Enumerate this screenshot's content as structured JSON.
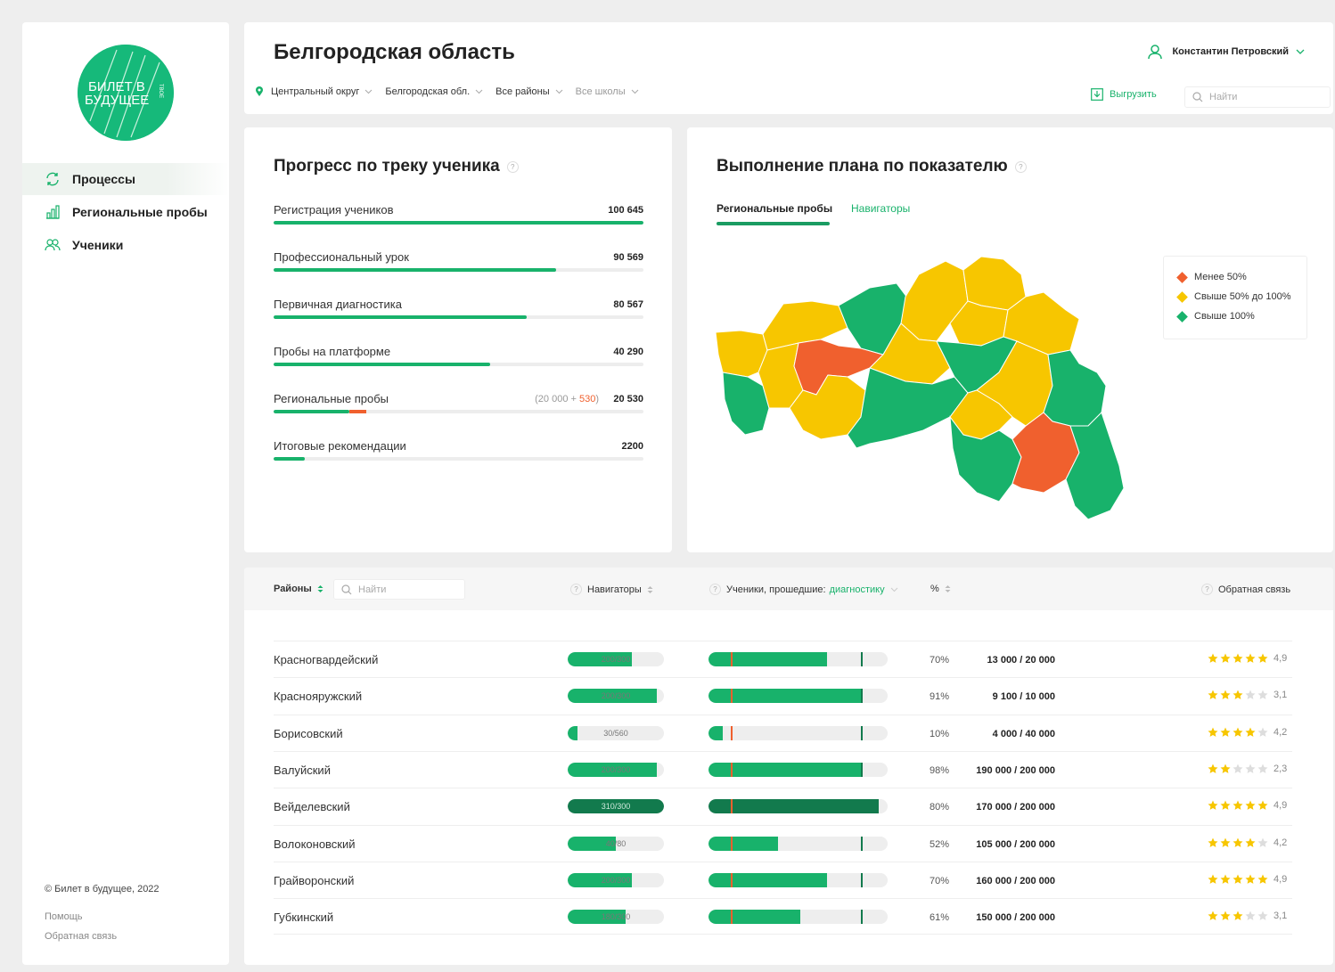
{
  "sidebar": {
    "logo_line1": "БИЛЕТ В",
    "logo_line2": "БУДУЩЕЕ",
    "logo_side": "ТВОЕ",
    "items": [
      {
        "label": "Процессы",
        "icon": "refresh-icon"
      },
      {
        "label": "Региональные пробы",
        "icon": "bar-chart-icon"
      },
      {
        "label": "Ученики",
        "icon": "users-icon"
      }
    ],
    "copyright": "© Билет в будущее, 2022",
    "help_link": "Помощь",
    "feedback_link": "Обратная связь"
  },
  "header": {
    "title": "Белгородская область",
    "user_name": "Константин Петровский",
    "filters": [
      "Центральный округ",
      "Белгородская обл.",
      "Все районы",
      "Все школы"
    ],
    "export_label": "Выгрузить",
    "search_placeholder": "Найти"
  },
  "progress": {
    "title": "Прогресс по треку ученика",
    "help": "?",
    "rows": [
      {
        "label": "Регистрация учеников",
        "value": "100 645",
        "fill": 1.0
      },
      {
        "label": "Профессиональный урок",
        "value": "90 569",
        "fill": 0.765
      },
      {
        "label": "Первичная диагностика",
        "value": "80 567",
        "fill": 0.685
      },
      {
        "label": "Пробы на платформе",
        "value": "40 290",
        "fill": 0.585
      },
      {
        "label": "Региональные пробы",
        "value": "20 530",
        "extra_base": "(20 000 + ",
        "extra_add": "530",
        "extra_close": ")",
        "fill": 0.205,
        "fill_add": 0.045
      },
      {
        "label": "Итоговые рекомендации",
        "value": "2200",
        "fill": 0.085
      }
    ]
  },
  "plan": {
    "title": "Выполнение плана по показателю",
    "help": "?",
    "tabs": [
      "Региональные пробы",
      "Навигаторы"
    ],
    "legend": [
      {
        "label": "Менее 50%",
        "color": "#f0602e"
      },
      {
        "label": "Свыше 50% до 100%",
        "color": "#f7c600"
      },
      {
        "label": "Свыше 100%",
        "color": "#18b26b"
      }
    ]
  },
  "table": {
    "headers": {
      "districts": "Районы",
      "search_placeholder": "Найти",
      "navigators": "Навигаторы",
      "students_prefix": "Ученики, прошедшие:",
      "students_link": "диагностику",
      "percent": "%",
      "feedback": "Обратная связь"
    },
    "rows": [
      {
        "name": "Красногвардейский",
        "nav_text": "200/300",
        "nav_fill": 0.667,
        "stu_fill": 0.66,
        "pct": "70%",
        "ratio": "13 000 / 20 000",
        "stars": 5,
        "rating": "4,9"
      },
      {
        "name": "Краснояружский",
        "nav_text": "200/300",
        "nav_fill": 0.93,
        "stu_fill": 0.86,
        "pct": "91%",
        "ratio": "9 100 / 10 000",
        "stars": 3,
        "rating": "3,1"
      },
      {
        "name": "Борисовский",
        "nav_text": "30/560",
        "nav_fill": 0.1,
        "stu_fill": 0.08,
        "pct": "10%",
        "ratio": "4 000 / 40 000",
        "stars": 4,
        "rating": "4,2"
      },
      {
        "name": "Валуйский",
        "nav_text": "200/300",
        "nav_fill": 0.93,
        "stu_fill": 0.86,
        "pct": "98%",
        "ratio": "190 000 / 200 000",
        "stars": 2,
        "rating": "2,3"
      },
      {
        "name": "Вейделевский",
        "nav_text": "310/300",
        "nav_fill": 1.0,
        "stu_fill": 0.95,
        "pct": "80%",
        "ratio": "170 000 / 200 000",
        "stars": 5,
        "rating": "4,9",
        "over": true
      },
      {
        "name": "Волоконовский",
        "nav_text": "40/80",
        "nav_fill": 0.5,
        "stu_fill": 0.39,
        "pct": "52%",
        "ratio": "105 000 / 200 000",
        "stars": 4,
        "rating": "4,2"
      },
      {
        "name": "Грайворонский",
        "nav_text": "200/300",
        "nav_fill": 0.667,
        "stu_fill": 0.66,
        "pct": "70%",
        "ratio": "160 000 / 200 000",
        "stars": 5,
        "rating": "4,9"
      },
      {
        "name": "Губкинский",
        "nav_text": "180/300",
        "nav_fill": 0.6,
        "stu_fill": 0.51,
        "pct": "61%",
        "ratio": "150 000 / 200 000",
        "stars": 3,
        "rating": "3,1"
      }
    ]
  },
  "colors": {
    "accent": "#18b26b",
    "accent_dark": "#127a4d",
    "warn": "#f0602e",
    "mid": "#f7c600"
  }
}
